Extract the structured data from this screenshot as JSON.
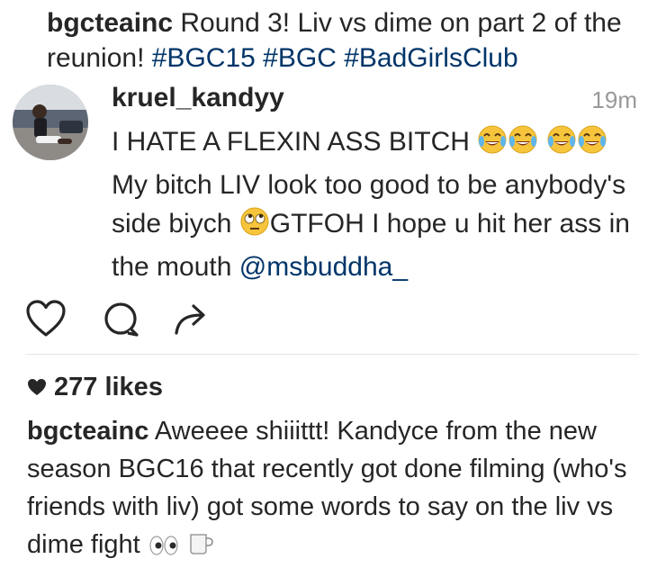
{
  "top_caption": {
    "username": "bgcteainc",
    "text": " Round 3! Liv vs dime on part 2 of the reunion! ",
    "hashtags": [
      "#BGC15",
      "#BGC",
      "#BadGirlsClub"
    ]
  },
  "comment": {
    "username": "kruel_kandyy",
    "time": "19m",
    "line_part1": "I HATE A FLEXIN ASS BITCH ",
    "line_part2": "My bitch LIV look too good to be anybody's side biych ",
    "line_part3": "GTFOH I hope u hit her ass in the mouth ",
    "mention": "@msbuddha_",
    "emojis": [
      "tears-of-joy-emoji",
      "rolling-eyes-emoji"
    ]
  },
  "actions": {
    "icons": [
      "heart-icon",
      "comment-icon",
      "share-icon"
    ]
  },
  "likes": {
    "text": "277 likes"
  },
  "bottom_caption": {
    "username": "bgcteainc",
    "text": " Aweeee shiiittt! Kandyce from the new season BGC16 that recently got done filming (who's friends with liv) got some words to say on the liv vs dime fight ",
    "emojis": [
      "eyes-emoji",
      "coffee-cup-emoji"
    ]
  },
  "colors": {
    "text": "#262626",
    "link": "#003569",
    "meta": "#999999",
    "divider": "#e6e6e6"
  }
}
